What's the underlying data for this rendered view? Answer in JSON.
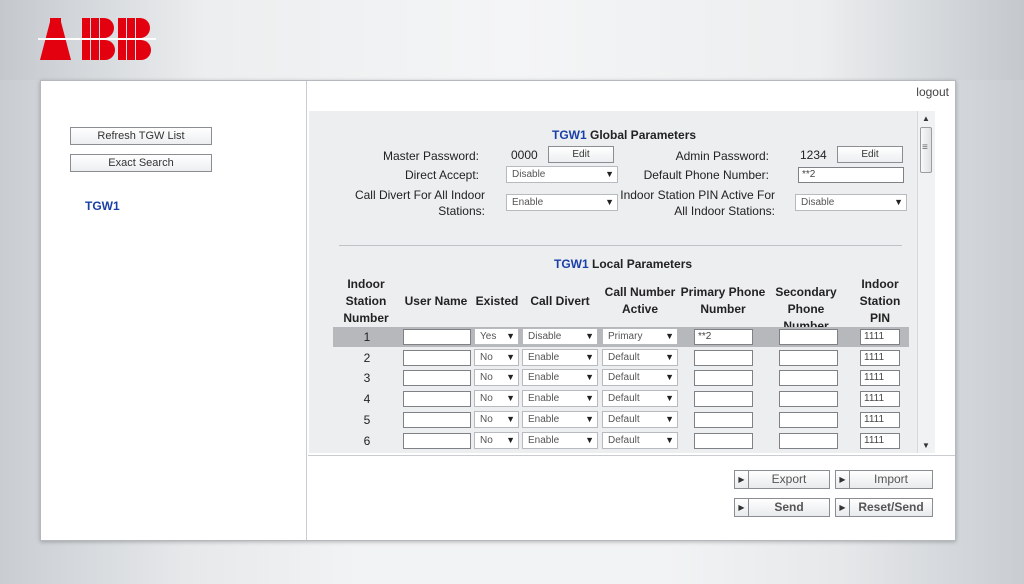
{
  "brand": {
    "logo_text": "ABB",
    "logo_color": "#e3000f"
  },
  "header": {
    "logout_label": "logout"
  },
  "sidebar": {
    "refresh_label": "Refresh TGW List",
    "search_label": "Exact Search",
    "gateway_item": "TGW1"
  },
  "global": {
    "gateway": "TGW1",
    "title": "Global Parameters",
    "master_password_label": "Master Password:",
    "master_password_value": "0000",
    "admin_password_label": "Admin Password:",
    "admin_password_value": "1234",
    "edit_label": "Edit",
    "direct_accept_label": "Direct Accept:",
    "direct_accept_value": "Disable",
    "default_phone_label": "Default Phone Number:",
    "default_phone_value": "**2",
    "call_divert_label_1": "Call Divert For All Indoor",
    "call_divert_label_2": "Stations:",
    "call_divert_value": "Enable",
    "pin_active_label_1": "Indoor Station PIN Active For",
    "pin_active_label_2": "All Indoor Stations:",
    "pin_active_value": "Disable"
  },
  "local": {
    "gateway": "TGW1",
    "title": "Local Parameters",
    "columns": {
      "station": [
        "Indoor",
        "Station",
        "Number"
      ],
      "user_name": "User Name",
      "existed": "Existed",
      "call_divert": "Call Divert",
      "call_number": [
        "Call Number",
        "Active"
      ],
      "primary": [
        "Primary Phone",
        "Number"
      ],
      "secondary": [
        "Secondary",
        "Phone Number"
      ],
      "pin": [
        "Indoor",
        "Station",
        "PIN"
      ]
    },
    "rows": [
      {
        "num": "1",
        "user": "",
        "existed": "Yes",
        "divert": "Disable",
        "active": "Primary",
        "primary": "**2",
        "secondary": "",
        "pin": "1111"
      },
      {
        "num": "2",
        "user": "",
        "existed": "No",
        "divert": "Enable",
        "active": "Default",
        "primary": "",
        "secondary": "",
        "pin": "1111"
      },
      {
        "num": "3",
        "user": "",
        "existed": "No",
        "divert": "Enable",
        "active": "Default",
        "primary": "",
        "secondary": "",
        "pin": "1111"
      },
      {
        "num": "4",
        "user": "",
        "existed": "No",
        "divert": "Enable",
        "active": "Default",
        "primary": "",
        "secondary": "",
        "pin": "1111"
      },
      {
        "num": "5",
        "user": "",
        "existed": "No",
        "divert": "Enable",
        "active": "Default",
        "primary": "",
        "secondary": "",
        "pin": "1111"
      },
      {
        "num": "6",
        "user": "",
        "existed": "No",
        "divert": "Enable",
        "active": "Default",
        "primary": "",
        "secondary": "",
        "pin": "1111"
      }
    ]
  },
  "actions": {
    "export": "Export",
    "import": "Import",
    "send": "Send",
    "reset_send": "Reset/Send"
  },
  "icons": {
    "select_arrow": "dropdown-arrow-icon",
    "button_marker": "play-triangle-icon"
  }
}
